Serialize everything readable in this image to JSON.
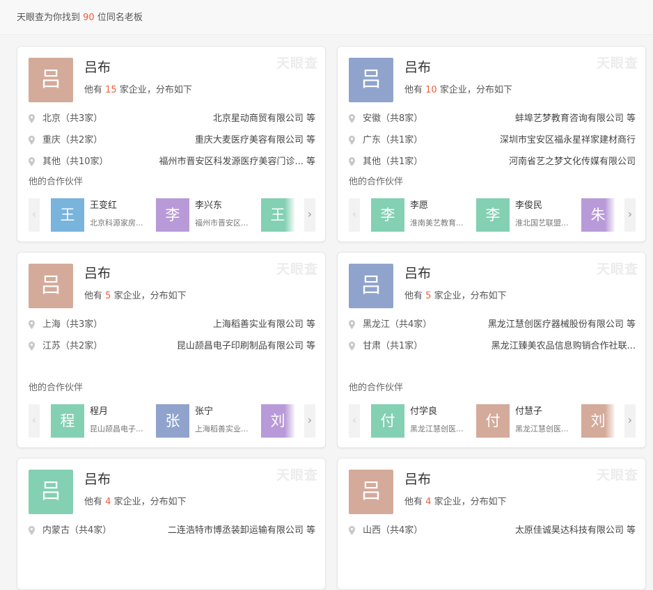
{
  "header": {
    "summary_prefix": "天眼查为你找到",
    "summary_count": "90",
    "summary_suffix": "位同名老板"
  },
  "colors": {
    "accent_red": "#f35b3b",
    "avatar_tan": "#d4aa9a",
    "avatar_blue": "#8fa3cc",
    "avatar_green": "#83d0b3",
    "avatar_lightblue": "#78b4dc",
    "avatar_purple": "#b99ad8"
  },
  "common": {
    "watermark": "天眼查",
    "count_prefix": "他有",
    "count_suffix": "家企业，分布如下",
    "partners_label": "他的合作伙伴",
    "arrow_left": "‹",
    "arrow_right": "›"
  },
  "cards": [
    {
      "avatar": "吕",
      "name": "吕布",
      "count": "15",
      "regions": [
        {
          "label": "北京（共3家）",
          "company": "北京星动商贸有限公司 等"
        },
        {
          "label": "重庆（共2家）",
          "company": "重庆大麦医疗美容有限公司 等"
        },
        {
          "label": "其他（共10家）",
          "company": "福州市晋安区科发源医疗美容门诊... 等"
        }
      ],
      "partners": [
        {
          "avatar": "王",
          "name": "王变红",
          "company": "北京科源家房..."
        },
        {
          "avatar": "李",
          "name": "李兴东",
          "company": "福州市晋安区..."
        },
        {
          "avatar": "王",
          "name": "",
          "company": ""
        }
      ]
    },
    {
      "avatar": "吕",
      "name": "吕布",
      "count": "10",
      "regions": [
        {
          "label": "安徽（共8家）",
          "company": "蚌埠艺梦教育咨询有限公司 等"
        },
        {
          "label": "广东（共1家）",
          "company": "深圳市宝安区福永星祥家建材商行"
        },
        {
          "label": "其他（共1家）",
          "company": "河南省艺之梦文化传媒有限公司"
        }
      ],
      "partners": [
        {
          "avatar": "李",
          "name": "李愿",
          "company": "淮南美艺教育..."
        },
        {
          "avatar": "李",
          "name": "李俊民",
          "company": "淮北国艺联盟..."
        },
        {
          "avatar": "朱",
          "name": "",
          "company": ""
        }
      ]
    },
    {
      "avatar": "吕",
      "name": "吕布",
      "count": "5",
      "regions": [
        {
          "label": "上海（共3家）",
          "company": "上海稻善实业有限公司 等"
        },
        {
          "label": "江苏（共2家）",
          "company": "昆山颉昌电子印刷制品有限公司 等"
        }
      ],
      "partners": [
        {
          "avatar": "程",
          "name": "程月",
          "company": "昆山颉昌电子..."
        },
        {
          "avatar": "张",
          "name": "张宁",
          "company": "上海稻善实业..."
        },
        {
          "avatar": "刘",
          "name": "",
          "company": ""
        }
      ]
    },
    {
      "avatar": "吕",
      "name": "吕布",
      "count": "5",
      "regions": [
        {
          "label": "黑龙江（共4家）",
          "company": "黑龙江慧创医疗器械股份有限公司 等"
        },
        {
          "label": "甘肃（共1家）",
          "company": "黑龙江臻美农品信息购销合作社联..."
        }
      ],
      "partners": [
        {
          "avatar": "付",
          "name": "付学良",
          "company": "黑龙江慧创医..."
        },
        {
          "avatar": "付",
          "name": "付慧子",
          "company": "黑龙江慧创医..."
        },
        {
          "avatar": "刘",
          "name": "",
          "company": ""
        }
      ]
    },
    {
      "avatar": "吕",
      "name": "吕布",
      "count": "4",
      "regions": [
        {
          "label": "内蒙古（共4家）",
          "company": "二连浩特市博丞装卸运输有限公司 等"
        }
      ],
      "partners": []
    },
    {
      "avatar": "吕",
      "name": "吕布",
      "count": "4",
      "regions": [
        {
          "label": "山西（共4家）",
          "company": "太原佳诚昊达科技有限公司 等"
        }
      ],
      "partners": []
    }
  ]
}
